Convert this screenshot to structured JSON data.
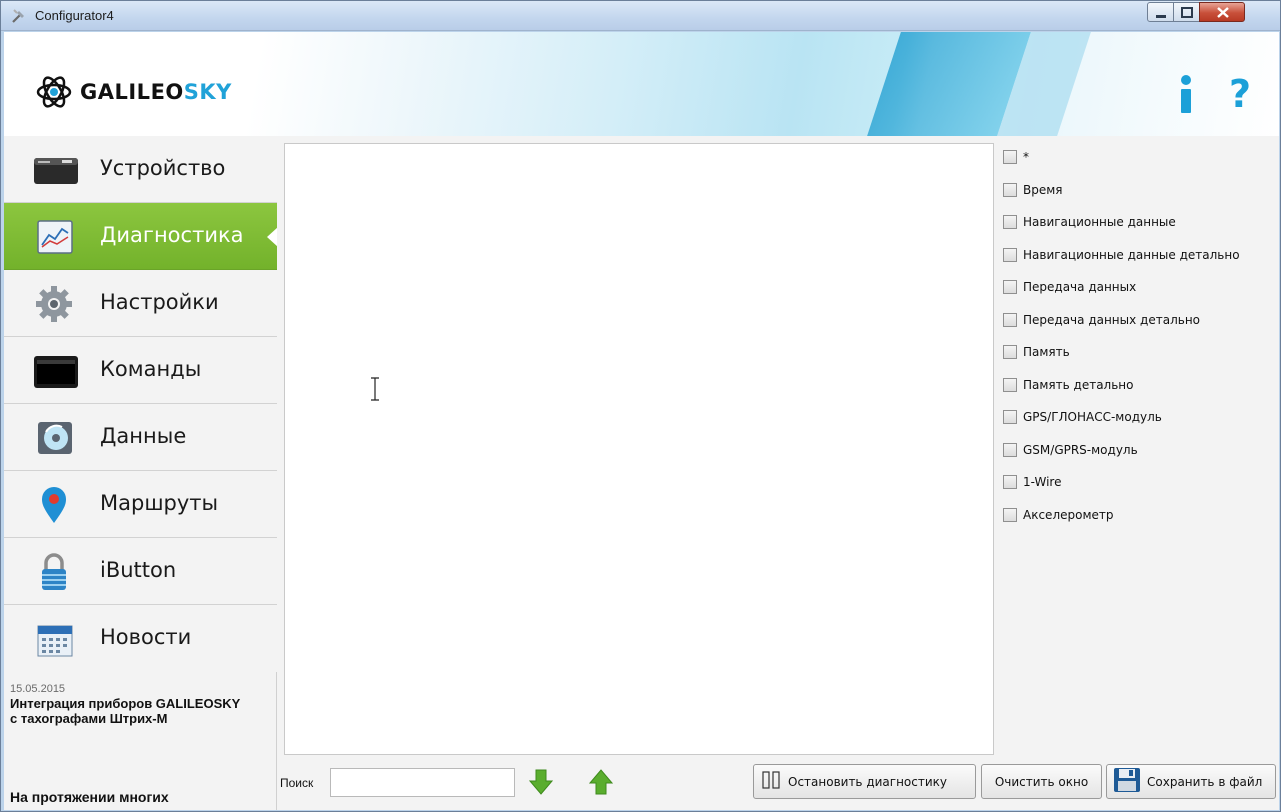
{
  "window": {
    "title": "Configurator4"
  },
  "header": {
    "logo_text_main": "GALILEO",
    "logo_text_accent": "SKY",
    "info_label": "i",
    "help_label": "?"
  },
  "sidebar": {
    "items": [
      {
        "label": "Устройство",
        "icon": "device-icon",
        "active": false
      },
      {
        "label": "Диагностика",
        "icon": "chart-icon",
        "active": true
      },
      {
        "label": "Настройки",
        "icon": "gear-icon",
        "active": false
      },
      {
        "label": "Команды",
        "icon": "terminal-icon",
        "active": false
      },
      {
        "label": "Данные",
        "icon": "disk-icon",
        "active": false
      },
      {
        "label": "Маршруты",
        "icon": "map-pin-icon",
        "active": false
      },
      {
        "label": "iButton",
        "icon": "lock-icon",
        "active": false
      },
      {
        "label": "Новости",
        "icon": "calendar-icon",
        "active": false
      }
    ],
    "news": {
      "date": "15.05.2015",
      "title": "Интеграция приборов GALILEOSKY с тахографами Штрих-М",
      "teaser": "На протяжении многих"
    }
  },
  "filters": [
    {
      "label": "*",
      "checked": false
    },
    {
      "label": "Время",
      "checked": false
    },
    {
      "label": "Навигационные данные",
      "checked": false
    },
    {
      "label": "Навигационные данные детально",
      "checked": false
    },
    {
      "label": "Передача данных",
      "checked": false
    },
    {
      "label": "Передача данных детально",
      "checked": false
    },
    {
      "label": "Память",
      "checked": false
    },
    {
      "label": "Память детально",
      "checked": false
    },
    {
      "label": "GPS/ГЛОНАСС-модуль",
      "checked": false
    },
    {
      "label": "GSM/GPRS-модуль",
      "checked": false
    },
    {
      "label": "1-Wire",
      "checked": false
    },
    {
      "label": "Акселерометр",
      "checked": false
    }
  ],
  "bottom": {
    "search_label": "Поиск",
    "search_value": "",
    "stop_label": "Остановить диагностику",
    "clear_label": "Очистить окно",
    "save_label": "Сохранить в файл"
  },
  "colors": {
    "accent_green": "#7ab934",
    "brand_blue": "#20a2d8",
    "arrow_green": "#5aad2e"
  }
}
